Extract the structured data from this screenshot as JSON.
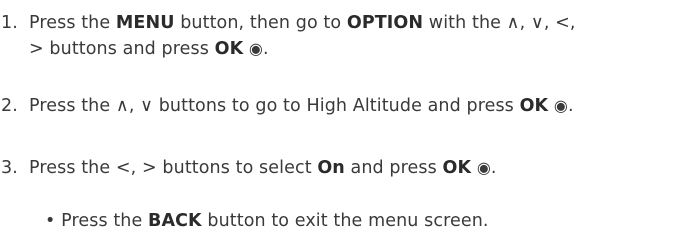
{
  "steps": [
    {
      "number": "1.",
      "line1": {
        "t1": "Press the ",
        "b1": "MENU",
        "t2": " button, then go to ",
        "b2": "OPTION",
        "t3": " with the ",
        "arrows": "∧, ∨, <,"
      },
      "line2": {
        "arrow": ">",
        "t1": " buttons and press ",
        "b1": "OK",
        "icon": "◉",
        "end": "."
      }
    },
    {
      "number": "2.",
      "t1": "Press the ",
      "arrows": "∧, ∨",
      "t2": " buttons to go to High Altitude and press ",
      "b1": "OK",
      "icon": "◉",
      "end": "."
    },
    {
      "number": "3.",
      "t1": "Press the ",
      "arrows": "<, >",
      "t2": " buttons to select ",
      "b1": "On",
      "t3": " and press ",
      "b2": "OK",
      "icon": "◉",
      "end": "."
    }
  ],
  "note": {
    "bullet": "•",
    "t1": " Press the ",
    "b1": "BACK",
    "t2": " button to exit the menu screen."
  }
}
